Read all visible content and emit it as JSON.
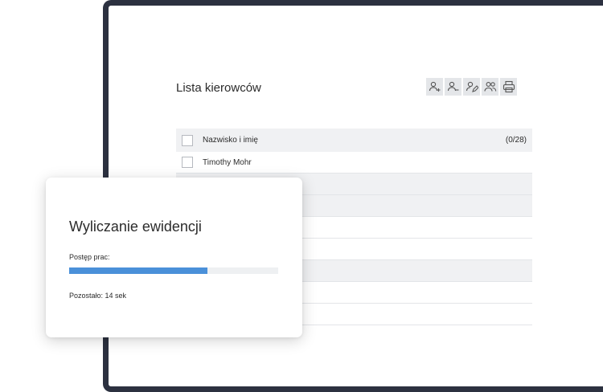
{
  "list": {
    "title": "Lista kierowców",
    "toolbar": [
      {
        "icon": "add-person-icon"
      },
      {
        "icon": "remove-person-icon"
      },
      {
        "icon": "edit-person-icon"
      },
      {
        "icon": "people-group-icon"
      },
      {
        "icon": "printer-icon"
      }
    ],
    "header": {
      "column": "Nazwisko i imię",
      "count": "(0/28)"
    },
    "rows": [
      {
        "name": "Timothy Mohr",
        "checked": false
      },
      {
        "name": "",
        "checked": true
      },
      {
        "name": "",
        "checked": false
      },
      {
        "name": "",
        "checked": false
      },
      {
        "name": "",
        "checked": false
      },
      {
        "name": "",
        "checked": false
      },
      {
        "name": "",
        "checked": false
      },
      {
        "name": "",
        "checked": false
      }
    ]
  },
  "dialog": {
    "title": "Wyliczanie ewidencji",
    "progress_label": "Postęp prac:",
    "progress_fraction": 0.66,
    "remaining": "Pozostało: 14 sek"
  },
  "colors": {
    "accent": "#4a90d9",
    "frame": "#2c3140",
    "row_alt": "#f0f1f3"
  }
}
